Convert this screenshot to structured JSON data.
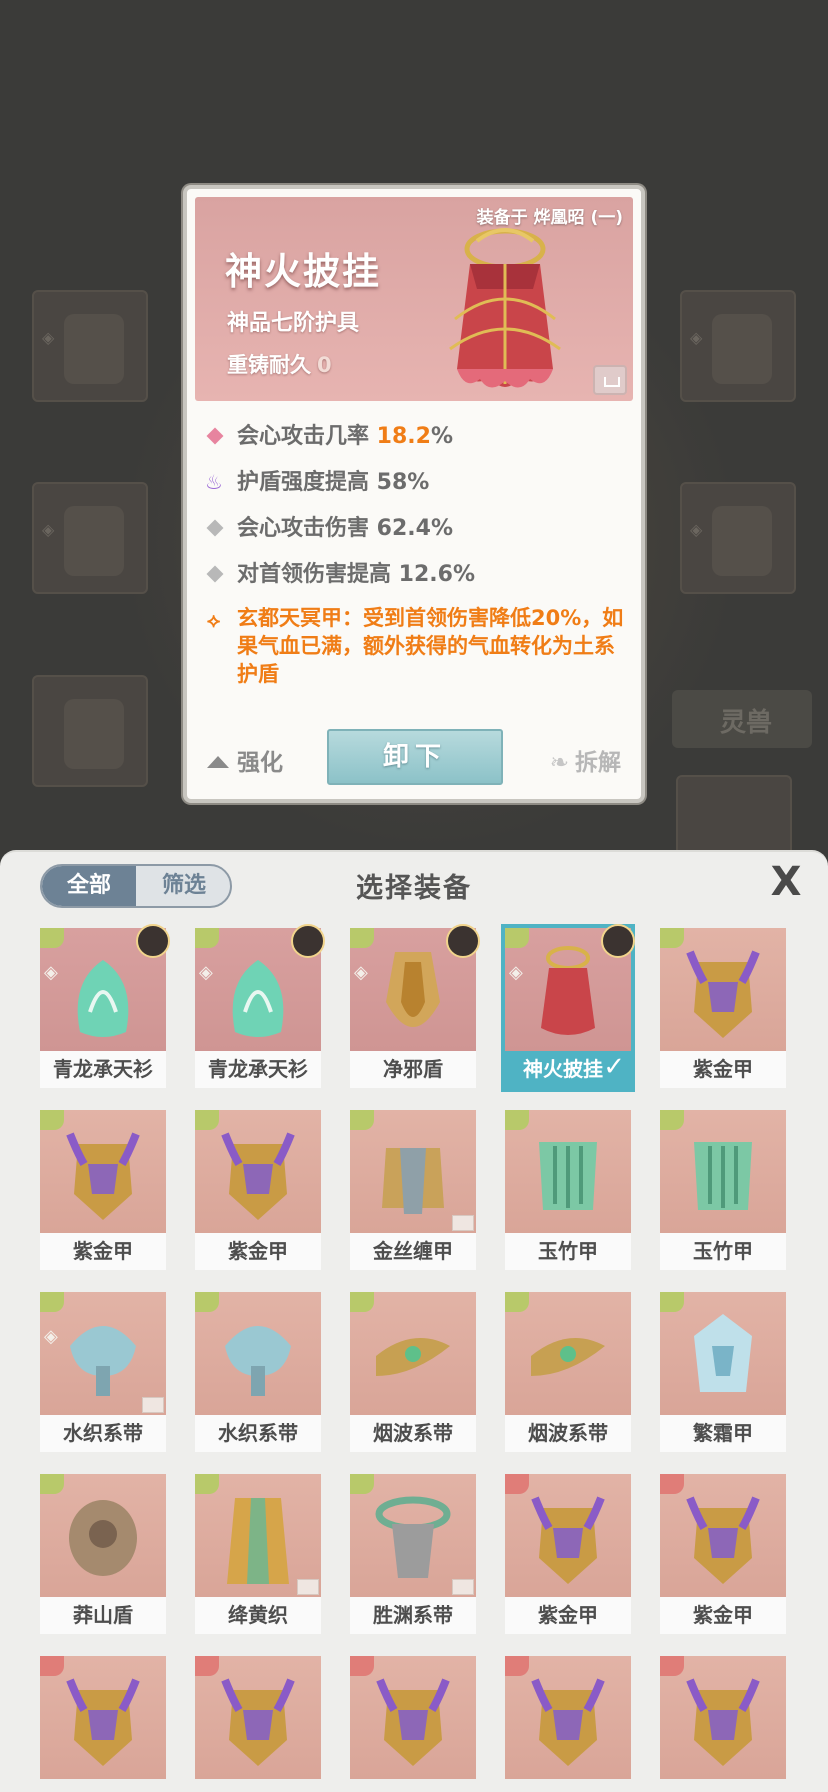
{
  "background": {
    "pet_tab_label": "灵兽"
  },
  "card": {
    "equipped_on": "装备于 烨凰昭 (一)",
    "name": "神火披挂",
    "grade": "神品七阶护具",
    "recast_label": "重铸耐久",
    "recast_value": "0",
    "stats": [
      {
        "icon": "pink-diamond-icon",
        "text": "会心攻击几率 ",
        "highlight": "18.2",
        "suffix": "%"
      },
      {
        "icon": "shield-rune-icon",
        "text": "护盾强度提高 58%"
      },
      {
        "icon": "gray-diamond-icon",
        "text": "会心攻击伤害 62.4%"
      },
      {
        "icon": "gray-diamond-icon",
        "text": "对首领伤害提高 12.6%"
      }
    ],
    "special": "玄都天冥甲：受到首领伤害降低20%，如果气血已满，额外获得的气血转化为土系护盾",
    "actions": {
      "strengthen": "强化",
      "unequip": "卸下",
      "dismantle": "拆解"
    }
  },
  "panel": {
    "title": "选择装备",
    "filter_all": "全部",
    "filter_filter": "筛选",
    "close": "X"
  },
  "items": [
    {
      "label": "青龙承天衫",
      "frame": "teal",
      "set": true,
      "owner": true
    },
    {
      "label": "青龙承天衫",
      "frame": "teal",
      "set": true,
      "owner": true
    },
    {
      "label": "净邪盾",
      "frame": "rose",
      "set": true,
      "owner": true
    },
    {
      "label": "神火披挂",
      "frame": "rose",
      "set": true,
      "owner": true,
      "selected": true
    },
    {
      "label": "紫金甲",
      "frame": "peach"
    },
    {
      "label": "紫金甲",
      "frame": "peach"
    },
    {
      "label": "紫金甲",
      "frame": "peach"
    },
    {
      "label": "金丝缠甲",
      "frame": "peach",
      "lock": true
    },
    {
      "label": "玉竹甲",
      "frame": "peach"
    },
    {
      "label": "玉竹甲",
      "frame": "peach"
    },
    {
      "label": "水织系带",
      "frame": "peach",
      "set": true,
      "lock": true
    },
    {
      "label": "水织系带",
      "frame": "peach"
    },
    {
      "label": "烟波系带",
      "frame": "peach"
    },
    {
      "label": "烟波系带",
      "frame": "peach"
    },
    {
      "label": "繁霜甲",
      "frame": "peach"
    },
    {
      "label": "莽山盾",
      "frame": "peach"
    },
    {
      "label": "绛黄织",
      "frame": "peach",
      "lock": true
    },
    {
      "label": "胜渊系带",
      "frame": "peach",
      "lock": true
    },
    {
      "label": "紫金甲",
      "frame": "peach",
      "red": true
    },
    {
      "label": "紫金甲",
      "frame": "peach",
      "red": true
    },
    {
      "label": "",
      "frame": "peach",
      "red": true
    },
    {
      "label": "",
      "frame": "peach",
      "red": true
    },
    {
      "label": "",
      "frame": "peach",
      "red": true
    },
    {
      "label": "",
      "frame": "peach",
      "red": true
    },
    {
      "label": "",
      "frame": "peach",
      "red": true
    }
  ],
  "colors": {
    "accent": "#4fb3c4",
    "highlight": "#f07d16",
    "seg_active": "#6d8295"
  }
}
